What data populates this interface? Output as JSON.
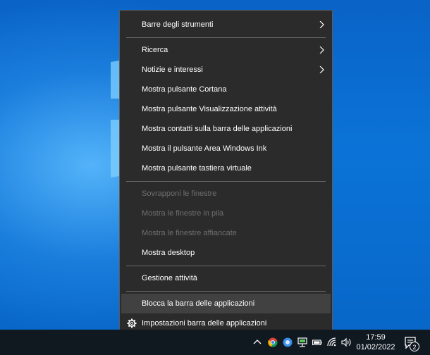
{
  "menu": {
    "items": [
      {
        "label": "Barre degli strumenti",
        "submenu": true
      },
      {
        "label": "Ricerca",
        "submenu": true
      },
      {
        "label": "Notizie e interessi",
        "submenu": true
      },
      {
        "label": "Mostra pulsante Cortana"
      },
      {
        "label": "Mostra pulsante Visualizzazione attività"
      },
      {
        "label": "Mostra contatti sulla barra delle applicazioni"
      },
      {
        "label": "Mostra il pulsante Area Windows Ink"
      },
      {
        "label": "Mostra pulsante tastiera virtuale"
      },
      {
        "label": "Sovrapponi le finestre",
        "disabled": true
      },
      {
        "label": "Mostra le finestre in pila",
        "disabled": true
      },
      {
        "label": "Mostra le finestre affiancate",
        "disabled": true
      },
      {
        "label": "Mostra desktop"
      },
      {
        "label": "Gestione attività"
      },
      {
        "label": "Blocca la barra delle applicazioni",
        "highlighted": true
      },
      {
        "label": "Impostazioni barra delle applicazioni",
        "icon": "gear-icon"
      }
    ]
  },
  "taskbar": {
    "time": "17:59",
    "date": "01/02/2022",
    "notification_count": "2",
    "tray_icons": [
      "chevron-up-icon",
      "chrome-icon",
      "app-icon",
      "network-device-icon",
      "battery-icon",
      "wifi-icon",
      "speaker-icon"
    ]
  },
  "colors": {
    "menu_bg": "#2b2b2b",
    "menu_highlight": "#414141",
    "menu_text": "#ffffff",
    "menu_disabled_text": "#6f6f6f",
    "taskbar_bg": "#101820",
    "desktop_blue": "#0b73d7"
  }
}
